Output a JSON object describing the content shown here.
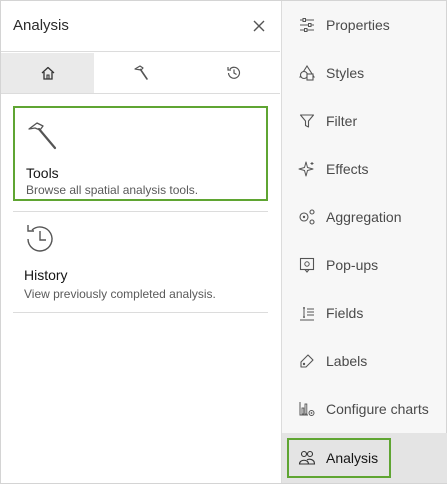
{
  "panel": {
    "title": "Analysis",
    "tabs": [
      {
        "name": "home",
        "icon": "home-icon"
      },
      {
        "name": "tools",
        "icon": "hammer-icon"
      },
      {
        "name": "history",
        "icon": "history-icon"
      }
    ],
    "active_tab": "home"
  },
  "cards": {
    "tools": {
      "title": "Tools",
      "description": "Browse all spatial analysis tools.",
      "icon": "hammer-icon"
    },
    "history": {
      "title": "History",
      "description": "View previously completed analysis.",
      "icon": "history-icon"
    }
  },
  "sidebar": {
    "items": [
      {
        "label": "Properties",
        "icon": "properties-icon"
      },
      {
        "label": "Styles",
        "icon": "styles-icon"
      },
      {
        "label": "Filter",
        "icon": "filter-icon"
      },
      {
        "label": "Effects",
        "icon": "effects-icon"
      },
      {
        "label": "Aggregation",
        "icon": "aggregation-icon"
      },
      {
        "label": "Pop-ups",
        "icon": "popups-icon"
      },
      {
        "label": "Fields",
        "icon": "fields-icon"
      },
      {
        "label": "Labels",
        "icon": "labels-icon"
      },
      {
        "label": "Configure charts",
        "icon": "configure-charts-icon"
      },
      {
        "label": "Analysis",
        "icon": "analysis-icon"
      }
    ],
    "active": "Analysis"
  },
  "colors": {
    "highlight": "#5fa532",
    "active_tab_bg": "#eaeaea",
    "sidebar_bg": "#f7f7f7",
    "sidebar_active_bg": "#e4e4e4"
  }
}
